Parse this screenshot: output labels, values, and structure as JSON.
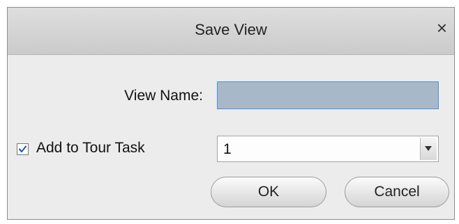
{
  "dialog": {
    "title": "Save View",
    "close_glyph": "×"
  },
  "form": {
    "view_name_label": "View Name:",
    "view_name_value": "",
    "add_to_tour_label": "Add to Tour Task",
    "add_to_tour_checked": true,
    "tour_task_selected": "1"
  },
  "buttons": {
    "ok_label": "OK",
    "cancel_label": "Cancel"
  },
  "icons": {
    "close": "close-icon",
    "checkmark": "checkmark-icon",
    "dropdown": "chevron-down-icon"
  },
  "colors": {
    "input_fill": "#a9b8c8",
    "input_border": "#4a90e2",
    "check_color": "#1f5fbf"
  }
}
